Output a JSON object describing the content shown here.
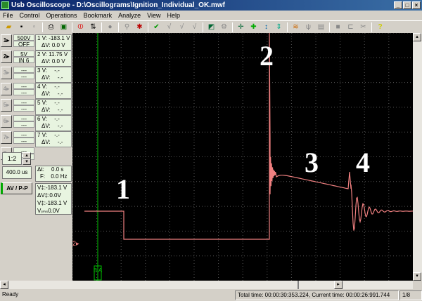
{
  "window": {
    "title": "Usb Oscilloscope - D:\\Oscillograms\\Ignition_Individual_OK.mwf",
    "min": "_",
    "max": "□",
    "close": "×"
  },
  "menu": [
    "File",
    "Control",
    "Operations",
    "Bookmark",
    "Analyze",
    "View",
    "Help"
  ],
  "channels": [
    {
      "btn": "1▸",
      "range": "500V",
      "coupling": "OFF",
      "n": "1",
      "v": "-183.1 V",
      "dv": "0.0 V"
    },
    {
      "btn": "2▸",
      "range": "5V",
      "coupling": "IN 6",
      "n": "2",
      "v": "11.75 V",
      "dv": "0.0 V"
    },
    {
      "btn": "3▸",
      "range": "---",
      "coupling": "---",
      "n": "3",
      "v": "-.-",
      "dv": "-.-"
    },
    {
      "btn": "4▸",
      "range": "---",
      "coupling": "---",
      "n": "4",
      "v": "-.-",
      "dv": "-.-"
    },
    {
      "btn": "5▸",
      "range": "---",
      "coupling": "---",
      "n": "5",
      "v": "-.-",
      "dv": "-.-"
    },
    {
      "btn": "6▸",
      "range": "---",
      "coupling": "---",
      "n": "6",
      "v": "-.-",
      "dv": "-.-"
    },
    {
      "btn": "7▸",
      "range": "---",
      "coupling": "---",
      "n": "7",
      "v": "-.-",
      "dv": "-.-"
    },
    {
      "btn": "8▸",
      "range": "---",
      "coupling": "---",
      "n": "8",
      "v": "-.-",
      "dv": "-.-"
    }
  ],
  "labels": {
    "v": "V:",
    "dv": "ΔV:"
  },
  "timing": {
    "dt_label": "Δt:",
    "dt": "0.0 s",
    "f_label": "F:",
    "f": "0.0 Hz"
  },
  "zoom": "1:2",
  "timebase": "400.0 us",
  "cursors": {
    "v1": "V‡:-183.1 V",
    "dv": "ΔV‡:0.0V",
    "v2": "V‡:-183.1 V",
    "vpp": "Vᵣₘₛ0.0V"
  },
  "avpp": "AV / P-P",
  "plot": {
    "annotations": [
      "1",
      "2",
      "3",
      "4"
    ],
    "ch2_marker": "2▸",
    "cursor_tag": "B A",
    "trace_color": "#f08080",
    "cursor_color": "#00c000"
  },
  "status": {
    "ready": "Ready",
    "times": "Total time: 00:00:30:353.224, Current time: 00:00:26:991.744",
    "page": "1/8"
  }
}
